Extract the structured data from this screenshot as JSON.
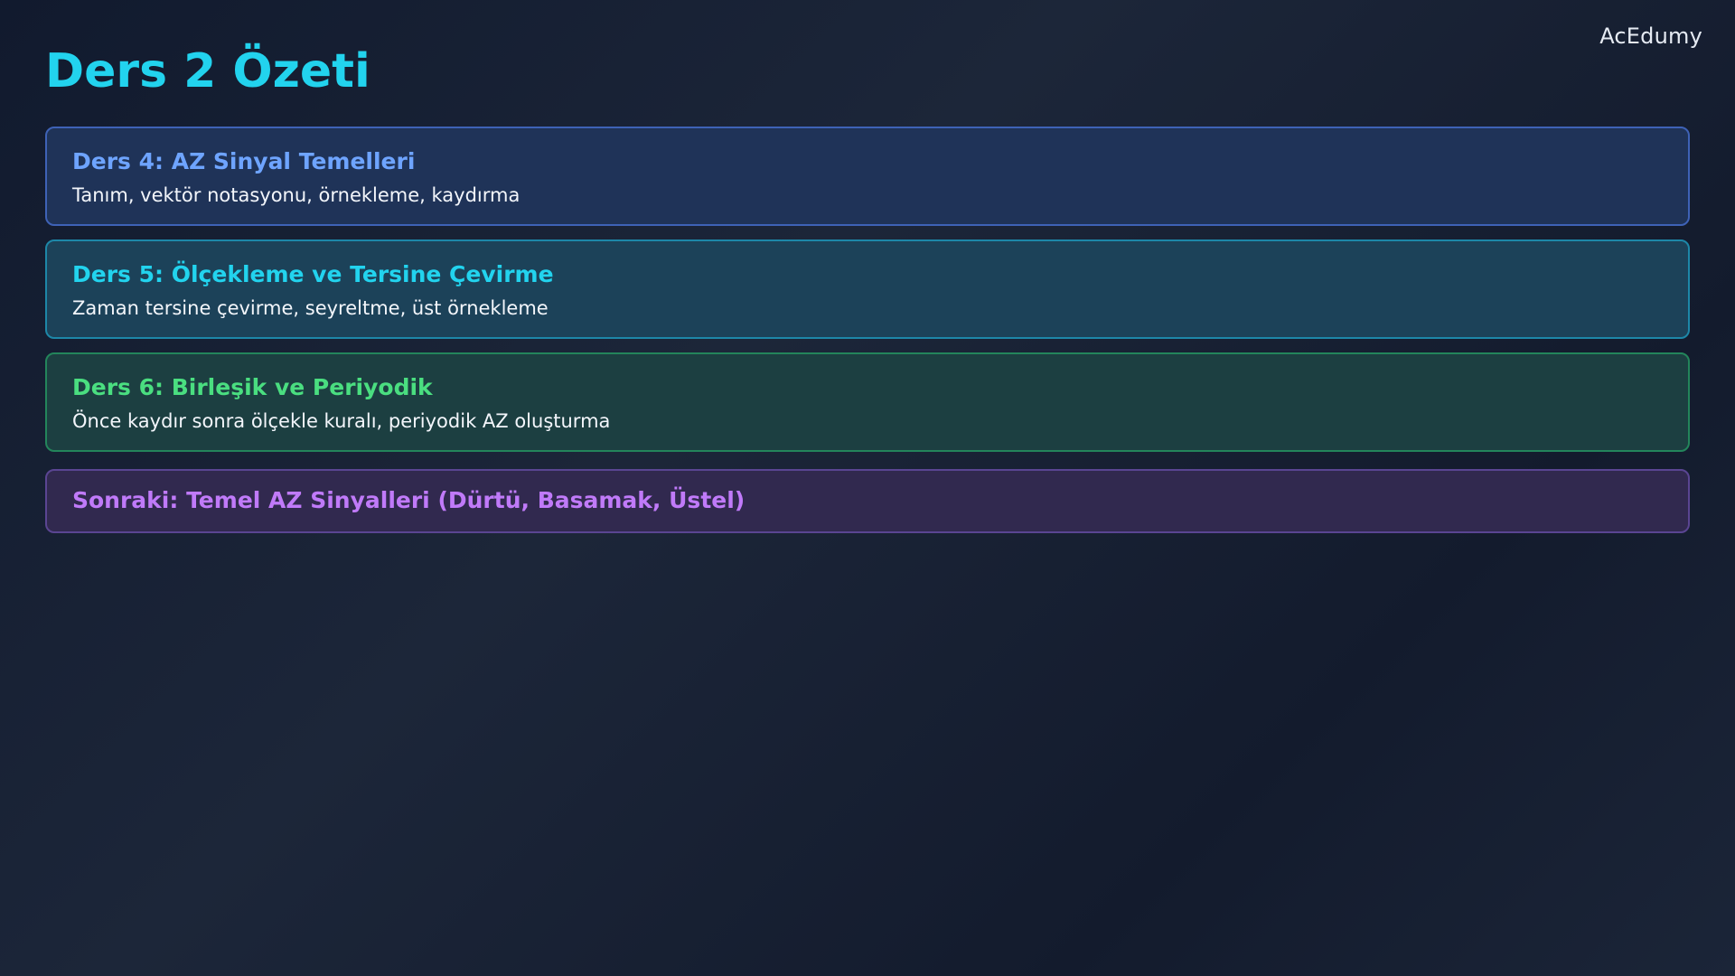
{
  "brand": "AcEdumy",
  "title": "Ders 2 Özeti",
  "cards": [
    {
      "title": "Ders 4: AZ Sinyal Temelleri",
      "description": "Tanım, vektör notasyonu, örnekleme, kaydırma",
      "accent": "#6ea4ff"
    },
    {
      "title": "Ders 5: Ölçekleme ve Tersine Çevirme",
      "description": "Zaman tersine çevirme, seyreltme, üst örnekleme",
      "accent": "#22d3ee"
    },
    {
      "title": "Ders 6: Birleşik ve Periyodik",
      "description": "Önce kaydır sonra ölçekle kuralı, periyodik AZ oluşturma",
      "accent": "#4ade80"
    }
  ],
  "next": {
    "title": "Sonraki: Temel AZ Sinyalleri (Dürtü, Basamak, Üstel)",
    "accent": "#c07af9"
  },
  "colors": {
    "background": "#161f33",
    "title": "#22d3ee"
  }
}
